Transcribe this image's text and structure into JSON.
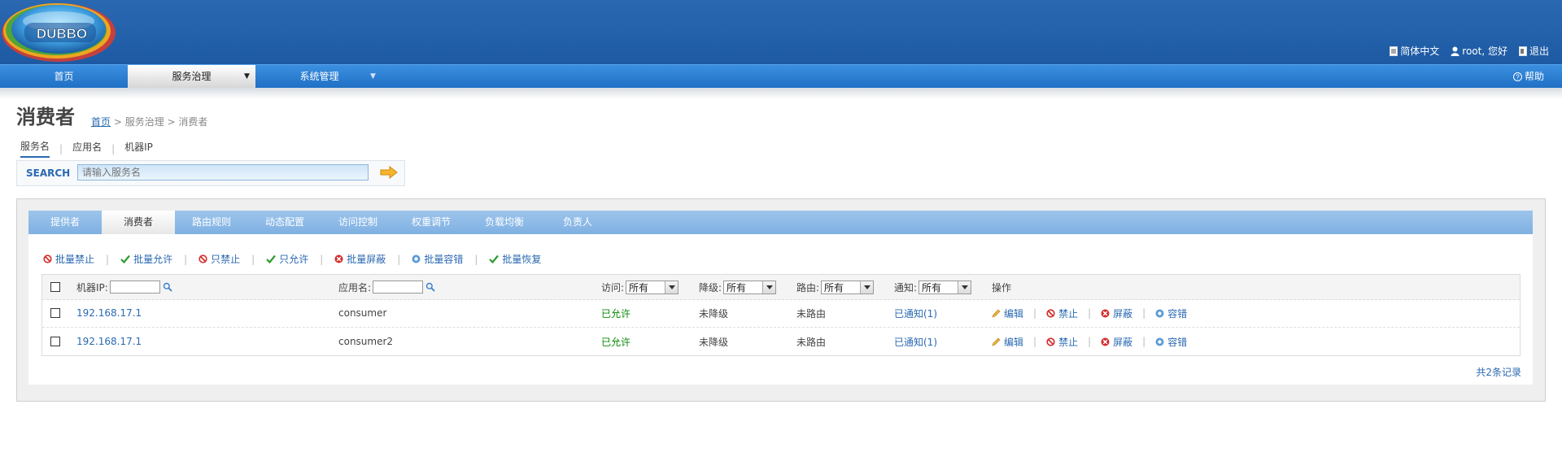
{
  "header": {
    "logo_text": "DUBBO",
    "language_link": "简体中文",
    "user_greeting": "root, 您好",
    "logout_link": "退出"
  },
  "nav": {
    "items": [
      {
        "label": "首页"
      },
      {
        "label": "服务治理",
        "active": true
      },
      {
        "label": "系统管理"
      }
    ],
    "help": "帮助"
  },
  "page": {
    "title": "消费者",
    "breadcrumb": {
      "home": "首页",
      "rest": " > 服务治理 > 消费者"
    }
  },
  "search": {
    "tabs": [
      "服务名",
      "应用名",
      "机器IP"
    ],
    "label": "SEARCH",
    "placeholder": "请输入服务名"
  },
  "panel_tabs": [
    "提供者",
    "消费者",
    "路由规则",
    "动态配置",
    "访问控制",
    "权重调节",
    "负载均衡",
    "负责人"
  ],
  "batch_actions": [
    {
      "label": "批量禁止",
      "icon": "ban-icon"
    },
    {
      "label": "批量允许",
      "icon": "check-icon"
    },
    {
      "label": "只禁止",
      "icon": "ban-icon"
    },
    {
      "label": "只允许",
      "icon": "check-icon"
    },
    {
      "label": "批量屏蔽",
      "icon": "block-icon"
    },
    {
      "label": "批量容错",
      "icon": "fault-tolerant-icon"
    },
    {
      "label": "批量恢复",
      "icon": "check-icon"
    }
  ],
  "table": {
    "headers": {
      "ip": "机器IP:",
      "app": "应用名:",
      "access": "访问:",
      "degrade": "降级:",
      "route": "路由:",
      "notify": "通知:",
      "ops": "操作"
    },
    "filter_value": "所有",
    "rows": [
      {
        "ip": "192.168.17.1",
        "app": "consumer",
        "access": "已允许",
        "degrade": "未降级",
        "route": "未路由",
        "notify": "已通知(1)"
      },
      {
        "ip": "192.168.17.1",
        "app": "consumer2",
        "access": "已允许",
        "degrade": "未降级",
        "route": "未路由",
        "notify": "已通知(1)"
      }
    ],
    "row_ops": {
      "edit": "编辑",
      "forbid": "禁止",
      "block": "屏蔽",
      "tolerate": "容错"
    },
    "total": "共2条记录"
  },
  "colors": {
    "header_blue": "#1d5aa3",
    "nav_blue": "#2f80d4",
    "tab_blue": "#8ebbe8",
    "link_blue": "#2a69b2",
    "allowed_green": "#0a8a0a"
  }
}
